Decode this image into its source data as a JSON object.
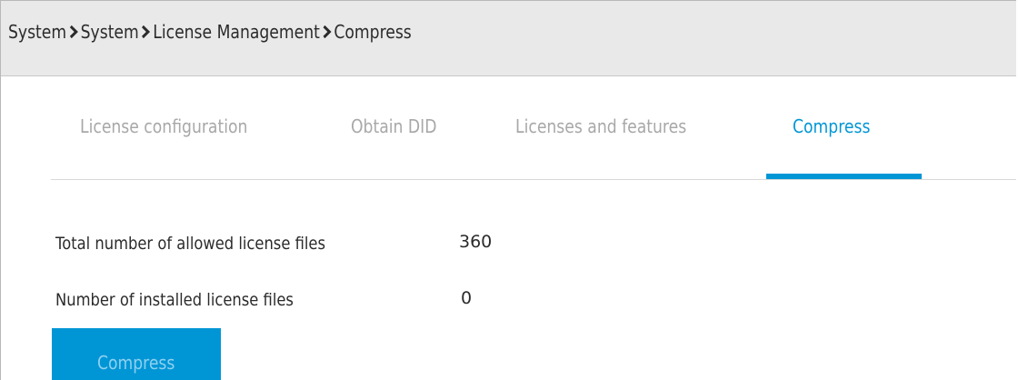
{
  "breadcrumb": {
    "items": [
      "System",
      "System",
      "License Management",
      "Compress"
    ],
    "separator_icon": "chevron-right-icon"
  },
  "tabs": [
    {
      "label": "License configuration",
      "active": false
    },
    {
      "label": "Obtain DID",
      "active": false
    },
    {
      "label": "Licenses and features",
      "active": false
    },
    {
      "label": "Compress",
      "active": true
    }
  ],
  "fields": {
    "allowed_label": "Total number of allowed license files",
    "allowed_value": "360",
    "installed_label": "Number of installed license files",
    "installed_value": "0"
  },
  "actions": {
    "compress_label": "Compress"
  },
  "colors": {
    "accent": "#0096d6",
    "header_bg": "#e9e9e9",
    "inactive_tab": "#a8a8a8",
    "text": "#2b2b2b"
  }
}
